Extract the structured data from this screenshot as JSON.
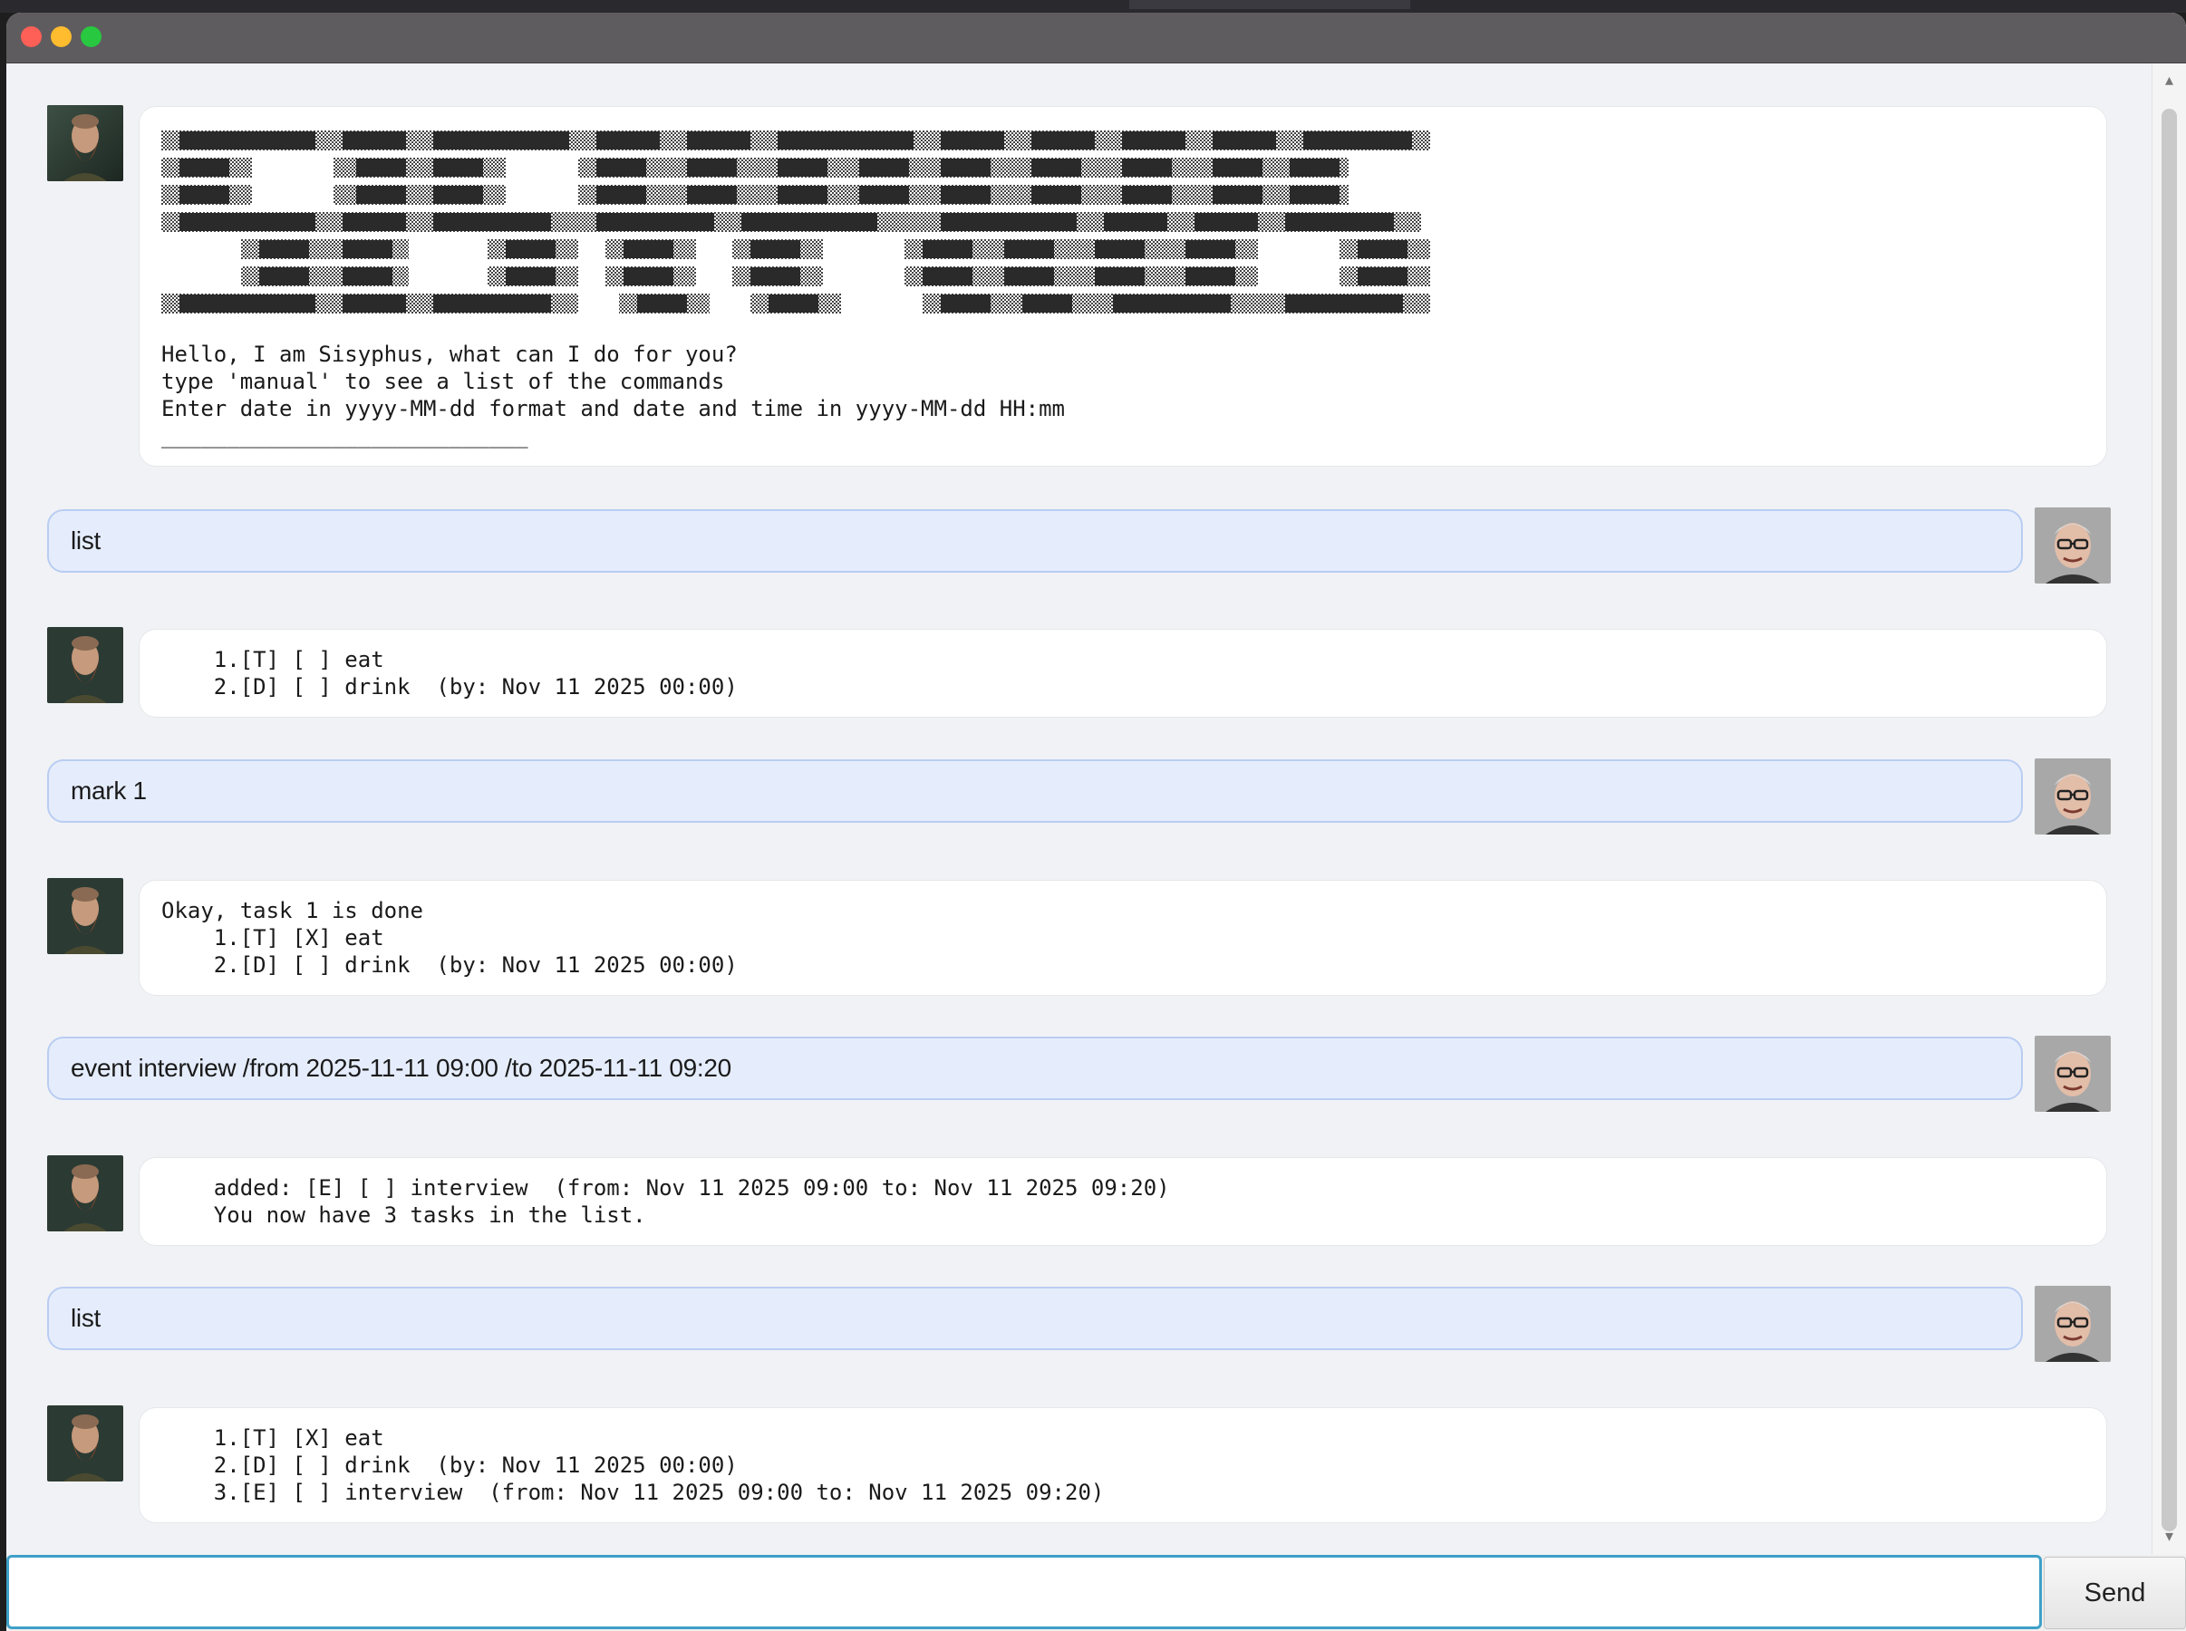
{
  "window": {
    "controls": [
      "close",
      "minimize",
      "maximize"
    ]
  },
  "messages": [
    {
      "sender": "bot",
      "lines": [
        "Hello, I am Sisyphus, what can I do for you?",
        "type 'manual' to see a list of the commands",
        "Enter date in yyyy-MM-dd format and date and time in yyyy-MM-dd HH:mm",
        "____________________________"
      ]
    },
    {
      "sender": "user",
      "text": "list"
    },
    {
      "sender": "bot",
      "lines": [
        "    1.[T] [ ] eat",
        "    2.[D] [ ] drink  (by: Nov 11 2025 00:00)"
      ]
    },
    {
      "sender": "user",
      "text": "mark 1"
    },
    {
      "sender": "bot",
      "lines": [
        "Okay, task 1 is done",
        "    1.[T] [X] eat",
        "    2.[D] [ ] drink  (by: Nov 11 2025 00:00)"
      ]
    },
    {
      "sender": "user",
      "text": "event interview /from 2025-11-11 09:00 /to 2025-11-11 09:20"
    },
    {
      "sender": "bot",
      "lines": [
        "    added: [E] [ ] interview  (from: Nov 11 2025 09:00 to: Nov 11 2025 09:20)",
        "    You now have 3 tasks in the list."
      ]
    },
    {
      "sender": "user",
      "text": "list"
    },
    {
      "sender": "bot",
      "lines": [
        "    1.[T] [X] eat",
        "    2.[D] [ ] drink  (by: Nov 11 2025 00:00)",
        "    3.[E] [ ] interview  (from: Nov 11 2025 09:00 to: Nov 11 2025 09:20)"
      ]
    }
  ],
  "input": {
    "value": "",
    "placeholder": ""
  },
  "send_button": {
    "label": "Send"
  },
  "icons": {
    "bot_avatar": "bearded-man-avatar-icon",
    "user_avatar": "man-with-glasses-avatar-icon"
  },
  "colors": {
    "user_bubble": "#e5edfc",
    "user_bubble_border": "#b9cdf2",
    "bot_bubble": "#ffffff",
    "input_focus": "#3ea0c8",
    "titlebar": "#5f5c5f"
  }
}
